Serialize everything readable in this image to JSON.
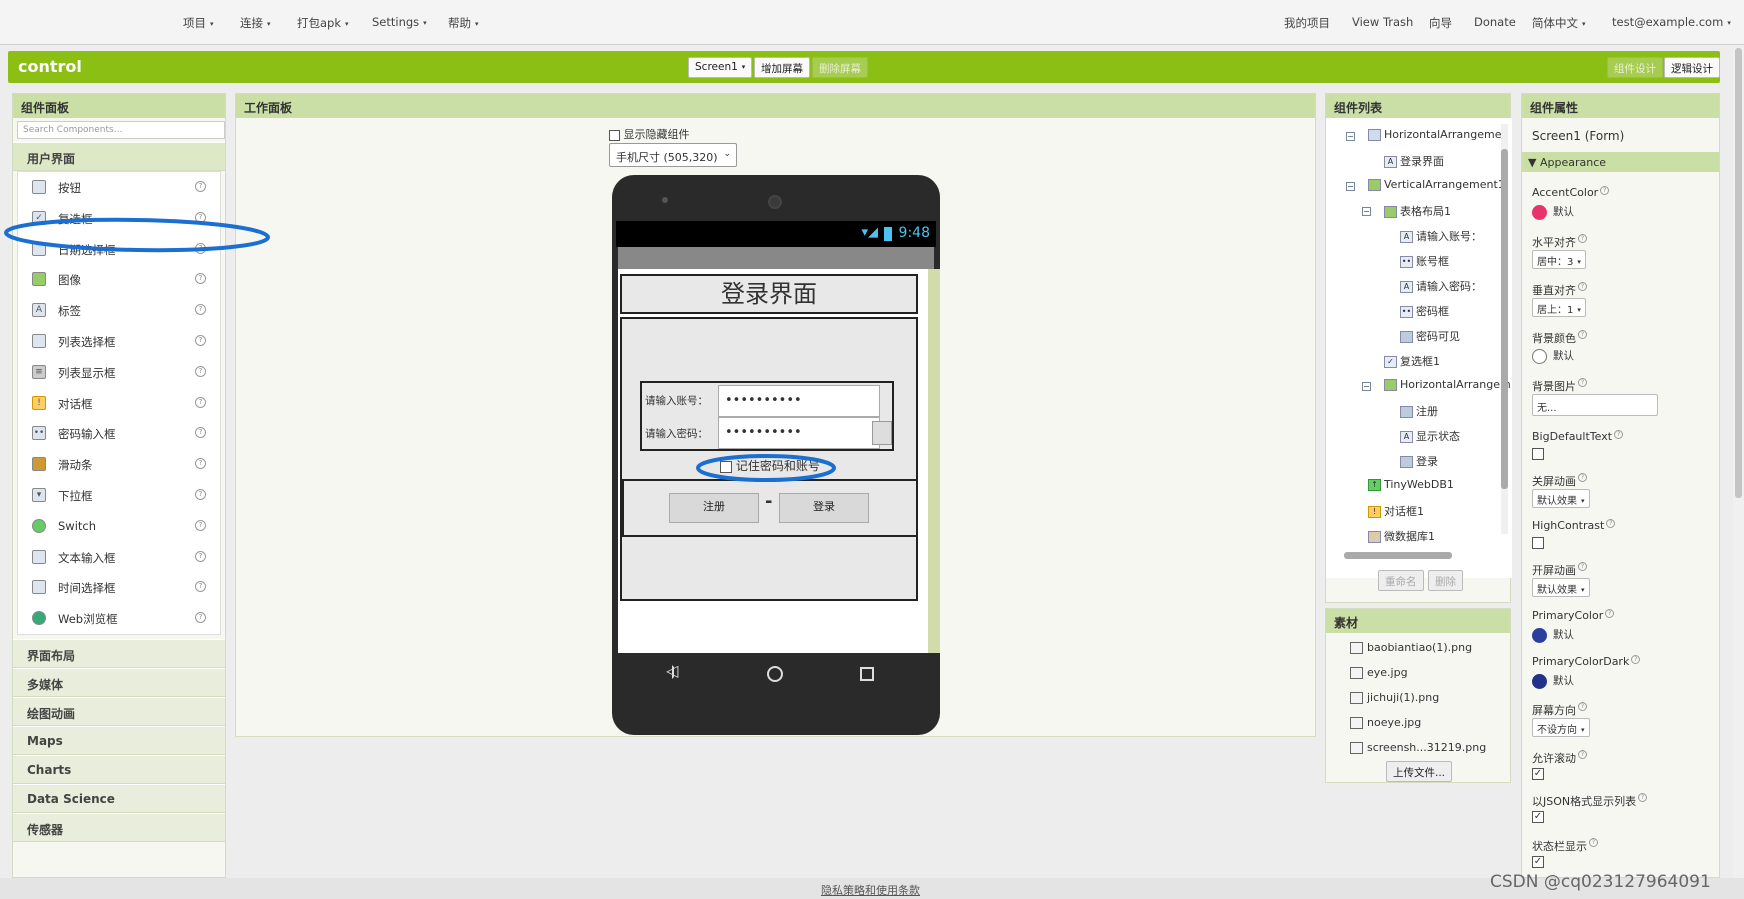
{
  "topnav": {
    "left": [
      "项目",
      "连接",
      "打包apk",
      "Settings",
      "帮助"
    ],
    "right": [
      "我的项目",
      "View Trash",
      "向导",
      "Donate"
    ],
    "language": "简体中文",
    "account": "test@example.com"
  },
  "project": {
    "name": "control",
    "screen_select": "Screen1",
    "add_screen": "增加屏幕",
    "remove_screen": "删除屏幕",
    "designer": "组件设计",
    "blocks": "逻辑设计"
  },
  "palette": {
    "title": "组件面板",
    "search_placeholder": "Search Components...",
    "active_category": "用户界面",
    "items": [
      "按钮",
      "复选框",
      "日期选择框",
      "图像",
      "标签",
      "列表选择框",
      "列表显示框",
      "对话框",
      "密码输入框",
      "滑动条",
      "下拉框",
      "Switch",
      "文本输入框",
      "时间选择框",
      "Web浏览框"
    ],
    "categories": [
      "界面布局",
      "多媒体",
      "绘图动画",
      "Maps",
      "Charts",
      "Data Science",
      "传感器"
    ],
    "help_glyph": "?"
  },
  "viewer": {
    "title": "工作面板",
    "show_hidden": "显示隐藏组件",
    "size_select": "手机尺寸 (505,320)",
    "status_time": "9:48",
    "app_title": "登录界面",
    "account_label": "请输入账号：",
    "account_value": "••••••••••",
    "password_label": "请输入密码：",
    "password_value": "••••••••••",
    "remember": "记住密码和账号",
    "register_btn": "注册",
    "separator": "-",
    "login_btn": "登录"
  },
  "components": {
    "title": "组件列表",
    "tree": [
      "HorizontalArrangemen",
      "登录界面",
      "VerticalArrangement1",
      "表格布局1",
      "请输入账号：",
      "账号框",
      "请输入密码：",
      "密码框",
      "密码可见",
      "复选框1",
      "HorizontalArrangem",
      "注册",
      "显示状态",
      "登录",
      "TinyWebDB1",
      "对话框1",
      "微数据库1"
    ],
    "rename": "重命名",
    "delete": "删除"
  },
  "media": {
    "title": "素材",
    "files": [
      "baobiantiao(1).png",
      "eye.jpg",
      "jichuji(1).png",
      "noeye.jpg",
      "screensh...31219.png"
    ],
    "upload": "上传文件..."
  },
  "properties": {
    "title": "组件属性",
    "component": "Screen1 (Form)",
    "section": "Appearance",
    "accent_label": "AccentColor",
    "accent_value": "默认",
    "accent_color": "#e8336c",
    "halign_label": "水平对齐",
    "halign_value": "居中：3",
    "valign_label": "垂直对齐",
    "valign_value": "居上：1",
    "bgcolor_label": "背景颜色",
    "bgcolor_value": "默认",
    "bgimage_label": "背景图片",
    "bgimage_value": "无...",
    "bigtext_label": "BigDefaultText",
    "closeanim_label": "关屏动画",
    "closeanim_value": "默认效果",
    "highcontrast_label": "HighContrast",
    "openanim_label": "开屏动画",
    "openanim_value": "默认效果",
    "primary_label": "PrimaryColor",
    "primary_value": "默认",
    "primary_color": "#2a3f9d",
    "primarydark_label": "PrimaryColorDark",
    "primarydark_value": "默认",
    "primarydark_color": "#22318a",
    "orientation_label": "屏幕方向",
    "orientation_value": "不设方向",
    "scroll_label": "允许滚动",
    "json_label": "以JSON格式显示列表",
    "statusbar_label": "状态栏显示"
  },
  "footer": {
    "privacy": "隐私策略和使用条款",
    "watermark": "CSDN @cq023127964091"
  },
  "colors": {
    "green": "#8cbf13",
    "panel_header": "#cadfa6",
    "annotation": "#1a6fd1"
  }
}
